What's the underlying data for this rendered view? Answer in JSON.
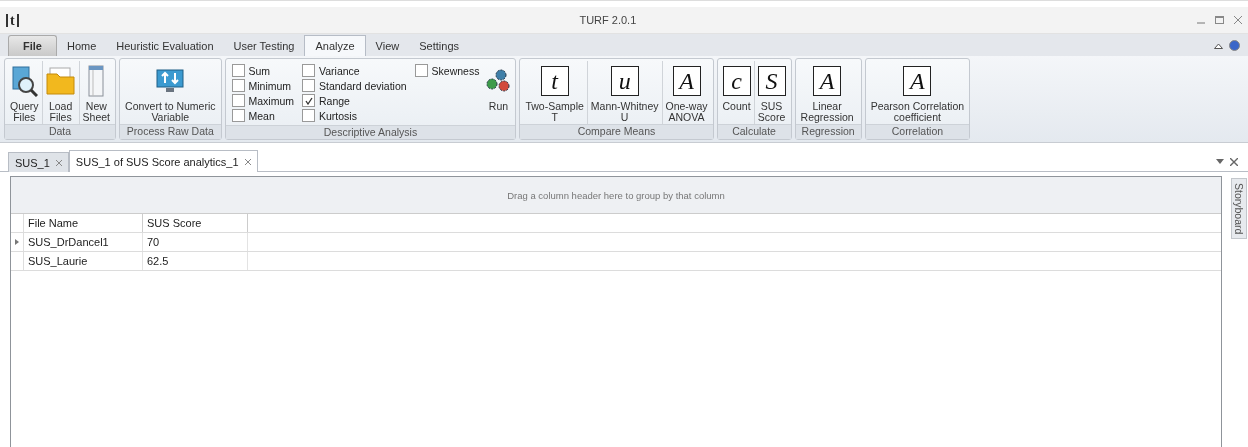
{
  "window": {
    "title": "TURF 2.0.1",
    "logo": "t"
  },
  "ribbon_tabs": [
    {
      "label": "File",
      "selected": false,
      "kind": "file"
    },
    {
      "label": "Home",
      "selected": false,
      "kind": "tab"
    },
    {
      "label": "Heuristic Evaluation",
      "selected": false,
      "kind": "tab"
    },
    {
      "label": "User Testing",
      "selected": false,
      "kind": "tab"
    },
    {
      "label": "Analyze",
      "selected": true,
      "kind": "tab"
    },
    {
      "label": "View",
      "selected": false,
      "kind": "tab"
    },
    {
      "label": "Settings",
      "selected": false,
      "kind": "tab"
    }
  ],
  "ribbon_groups": [
    {
      "label": "Data",
      "items": [
        {
          "kind": "icon",
          "label": "Query\nFiles"
        },
        {
          "kind": "icon",
          "label": "Load\nFiles"
        },
        {
          "kind": "icon",
          "label": "New\nSheet"
        }
      ]
    },
    {
      "label": "Process Raw Data",
      "items": [
        {
          "kind": "icon",
          "label": "Convert to Numeric\nVariable"
        }
      ]
    },
    {
      "label": "Descriptive Analysis",
      "items": [
        {
          "kind": "checkboxes",
          "checkboxes": [
            {
              "label": "Sum",
              "checked": false
            },
            {
              "label": "Minimum",
              "checked": false
            },
            {
              "label": "Maximum",
              "checked": false
            },
            {
              "label": "Mean",
              "checked": false
            },
            {
              "label": "Variance",
              "checked": false
            },
            {
              "label": "Standard deviation",
              "checked": false
            },
            {
              "label": "Range",
              "checked": true
            },
            {
              "label": "Kurtosis",
              "checked": false
            },
            {
              "label": "Skewness",
              "checked": false
            }
          ]
        },
        {
          "kind": "icon",
          "label": "Run"
        }
      ]
    },
    {
      "label": "Compare Means",
      "items": [
        {
          "kind": "glyph",
          "glyph": "t",
          "label": "Two-Sample\nT"
        },
        {
          "kind": "glyph",
          "glyph": "u",
          "label": "Mann-Whitney\nU"
        },
        {
          "kind": "glyph",
          "glyph": "A",
          "label": "One-way\nANOVA"
        }
      ]
    },
    {
      "label": "Calculate",
      "items": [
        {
          "kind": "glyph",
          "glyph": "c",
          "label": "Count"
        },
        {
          "kind": "glyph",
          "glyph": "S",
          "label": "SUS\nScore"
        }
      ]
    },
    {
      "label": "Regression",
      "items": [
        {
          "kind": "glyph",
          "glyph": "A",
          "label": "Linear\nRegression"
        }
      ]
    },
    {
      "label": "Correlation",
      "items": [
        {
          "kind": "glyph",
          "glyph": "A",
          "label": "Pearson Correlation\ncoefficient"
        }
      ]
    }
  ],
  "document_tabs": [
    {
      "label": "SUS_1",
      "selected": false
    },
    {
      "label": "SUS_1 of SUS Score analytics_1",
      "selected": true
    }
  ],
  "group_panel": "Drag a column header here to group by that column",
  "table": {
    "columns": [
      "File Name",
      "SUS Score"
    ],
    "rows": [
      {
        "cells": [
          "SUS_DrDancel1",
          "70"
        ],
        "current": true
      },
      {
        "cells": [
          "SUS_Laurie",
          "62.5"
        ],
        "current": false
      }
    ]
  },
  "side_panel": "Storyboard"
}
